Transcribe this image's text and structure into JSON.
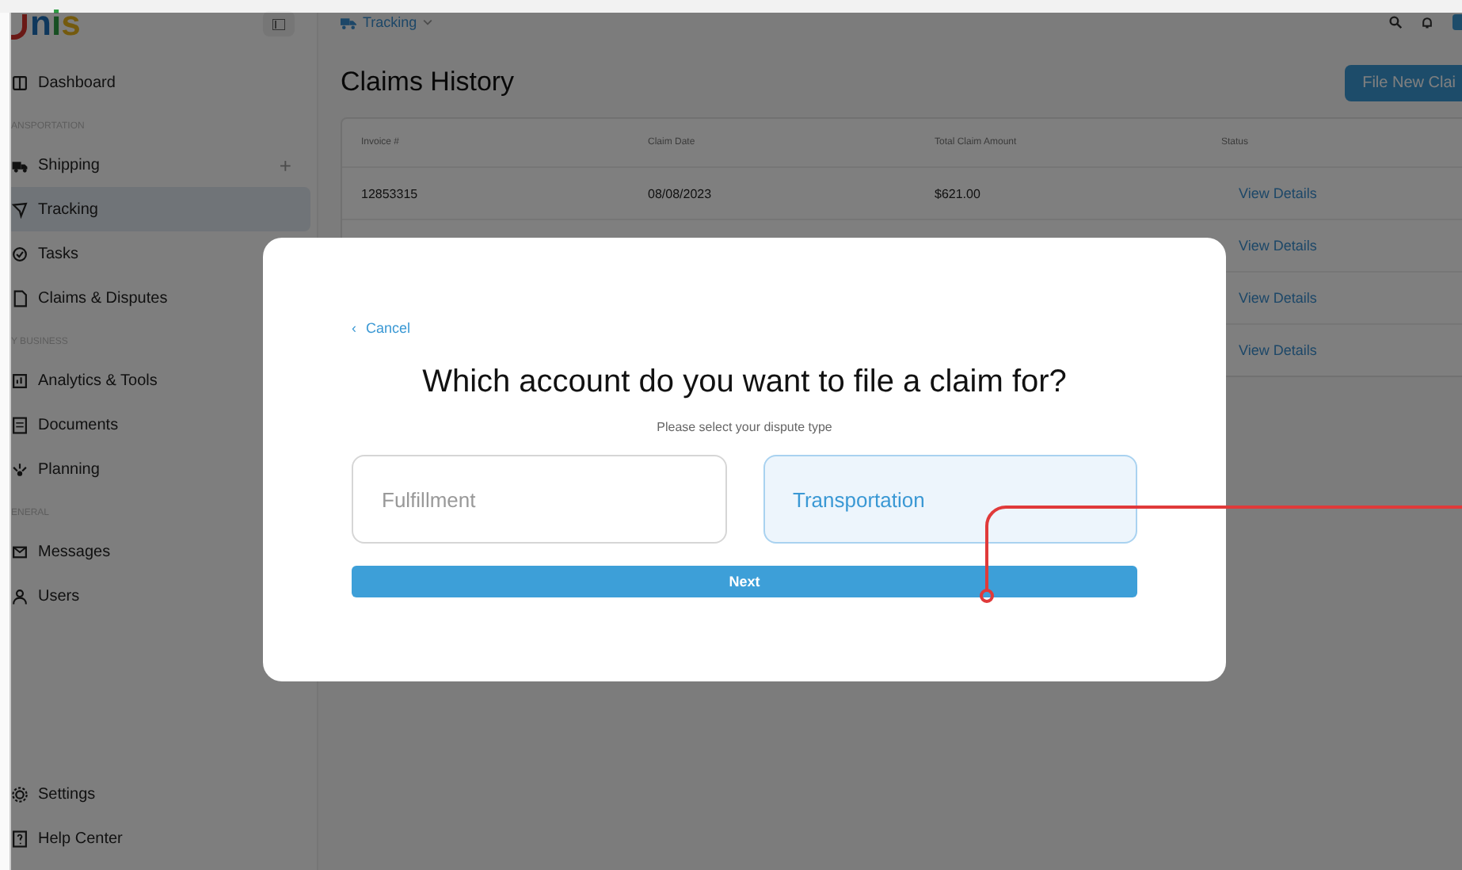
{
  "logo": {
    "letters": [
      "n",
      "i",
      "s"
    ]
  },
  "sidebar": {
    "sections": [
      {
        "items": [
          {
            "label": "Dashboard",
            "selected": false
          }
        ]
      },
      {
        "label": "ANSPORTATION",
        "items": [
          {
            "label": "Shipping",
            "selected": false,
            "action": "+"
          },
          {
            "label": "Tracking",
            "selected": true
          },
          {
            "label": "Tasks",
            "selected": false
          },
          {
            "label": "Claims & Disputes",
            "selected": false
          }
        ]
      },
      {
        "label": "Y BUSINESS",
        "items": [
          {
            "label": "Analytics & Tools",
            "selected": false
          },
          {
            "label": "Documents",
            "selected": false
          },
          {
            "label": "Planning",
            "selected": false
          }
        ]
      },
      {
        "label": "ENERAL",
        "items": [
          {
            "label": "Messages",
            "selected": false
          },
          {
            "label": "Users",
            "selected": false
          }
        ]
      }
    ],
    "bottom_items": [
      {
        "label": "Settings"
      },
      {
        "label": "Help Center"
      }
    ]
  },
  "breadcrumb": {
    "label": "Tracking"
  },
  "page_title": "Claims History",
  "new_claim_button": "File New Clai",
  "table": {
    "columns": [
      "Invoice #",
      "Claim Date",
      "Total Claim Amount",
      "Status"
    ],
    "rows": [
      {
        "invoice": "12853315",
        "date": "08/08/2023",
        "amount": "$621.00",
        "status": "View Details"
      },
      {
        "status": "View Details"
      },
      {
        "status": "View Details"
      },
      {
        "status": "View Details"
      }
    ]
  },
  "modal": {
    "back_link": "Cancel",
    "back_icon": "‹",
    "title": "Which account do you want to file a claim for?",
    "subtitle": "Please select your dispute type",
    "options": [
      {
        "label": "Fulfillment",
        "selected": false
      },
      {
        "label": "Transportation",
        "selected": true
      }
    ],
    "next_button": "Next"
  }
}
